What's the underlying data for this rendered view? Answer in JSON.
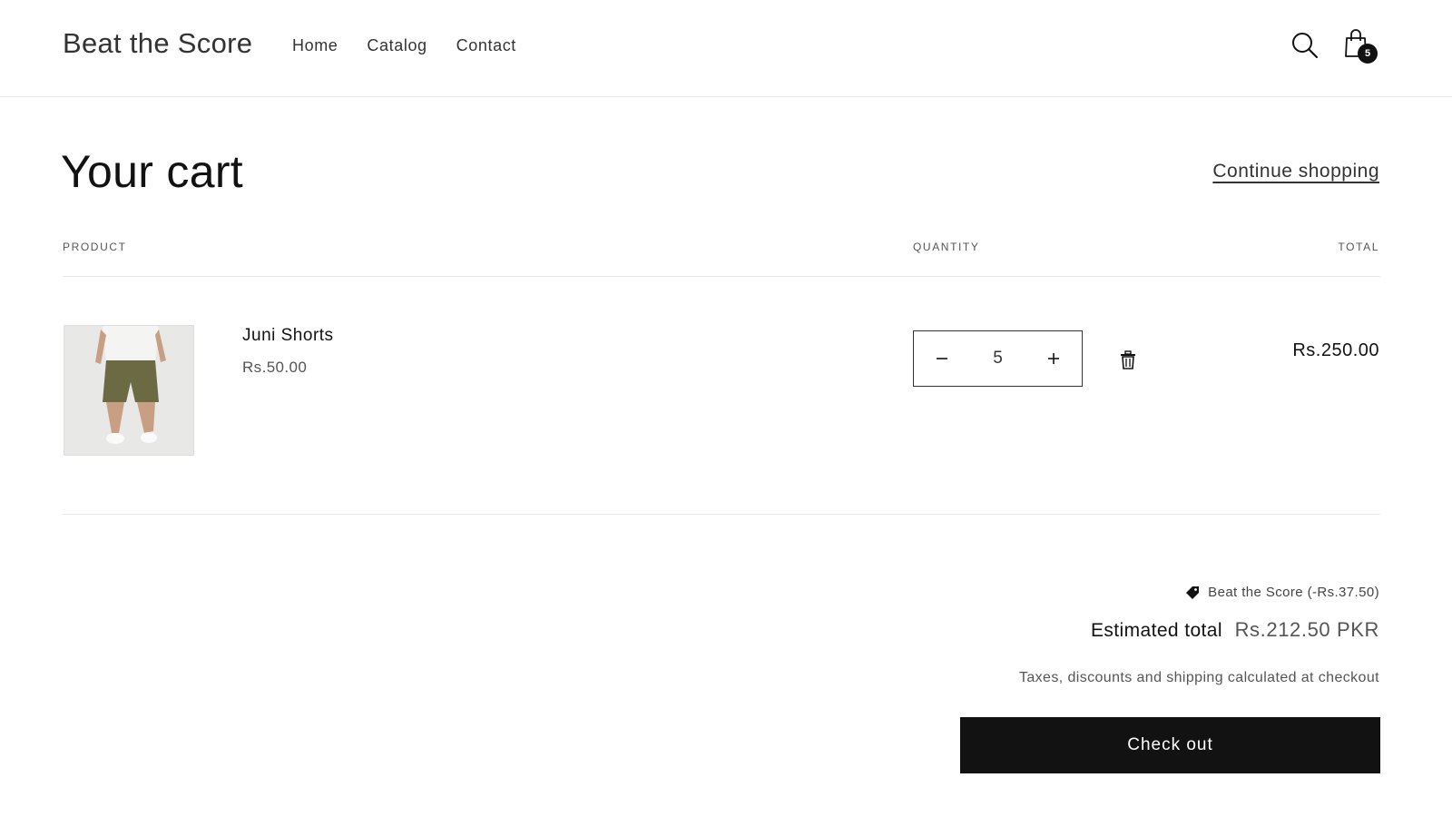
{
  "header": {
    "logo": "Beat the Score",
    "nav": [
      "Home",
      "Catalog",
      "Contact"
    ],
    "cart_count": "5"
  },
  "cart": {
    "title": "Your cart",
    "continue_label": "Continue shopping",
    "columns": {
      "product": "Product",
      "quantity": "Quantity",
      "total": "Total"
    },
    "items": [
      {
        "name": "Juni Shorts",
        "unit_price": "Rs.50.00",
        "quantity": "5",
        "line_total": "Rs.250.00",
        "image_subject": "model-in-olive-shorts"
      }
    ]
  },
  "summary": {
    "discount": "Beat the Score (-Rs.37.50)",
    "estimated_label": "Estimated total",
    "estimated_value": "Rs.212.50 PKR",
    "tax_note": "Taxes, discounts and shipping calculated at checkout",
    "checkout_label": "Check out"
  },
  "icons": {
    "search": "search-icon",
    "cart": "shopping-bag-icon",
    "minus": "minus-icon",
    "plus": "plus-icon",
    "remove": "trash-icon",
    "discount": "tag-icon"
  },
  "colors": {
    "text": "#121212",
    "button": "#121212",
    "muted": "#555555"
  }
}
